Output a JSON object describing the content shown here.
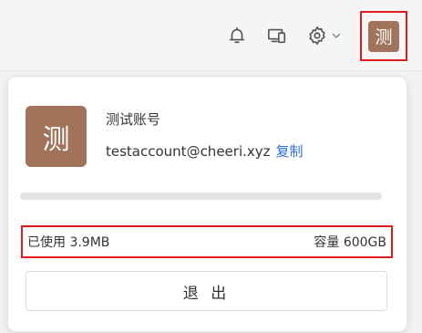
{
  "header": {
    "avatar_char": "测",
    "icons": [
      "bell-icon",
      "devices-icon",
      "gear-icon",
      "chevron-down-icon"
    ]
  },
  "account": {
    "avatar_char": "测",
    "name": "测试账号",
    "email": "testaccount@cheeri.xyz",
    "copy_label": "复制"
  },
  "storage": {
    "used_label": "已使用 3.9MB",
    "capacity_label": "容量 600GB",
    "used_fraction": 6.5e-06
  },
  "logout_label": "退 出",
  "colors": {
    "avatar_bg": "#a0735a",
    "link": "#2f6fd6",
    "highlight_border": "#e01b1b"
  }
}
